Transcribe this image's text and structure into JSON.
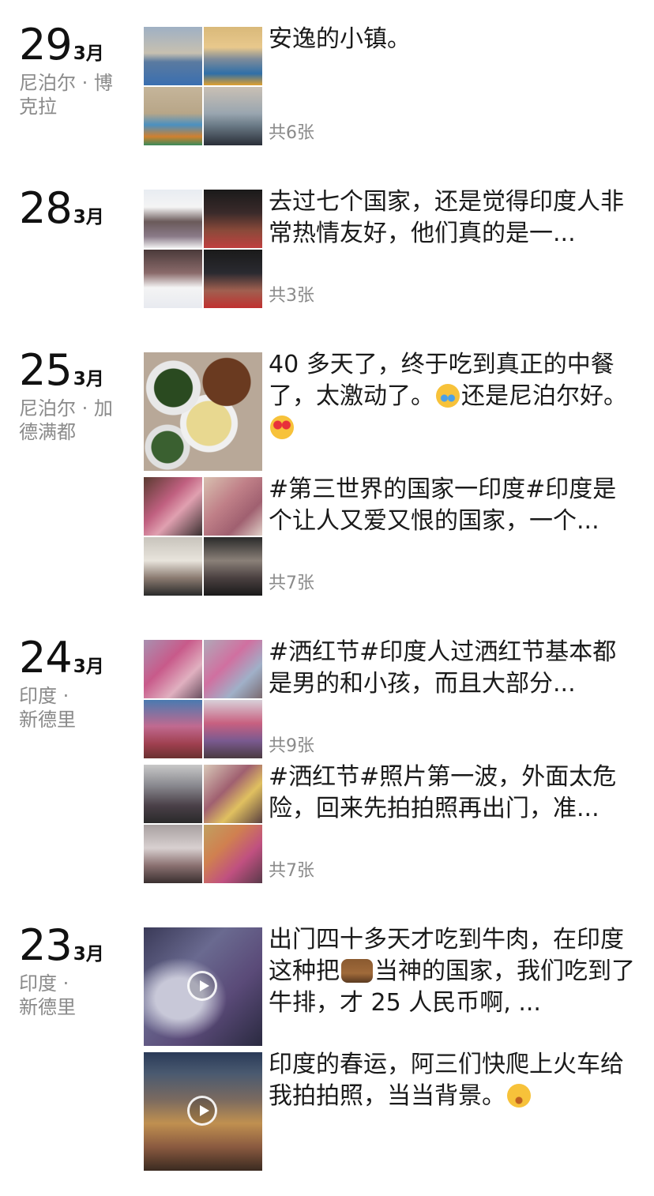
{
  "days": [
    {
      "day": "29",
      "month": "3月",
      "location": "尼泊尔 · 博克拉",
      "posts": [
        {
          "text": "安逸的小镇。",
          "count": "共6张"
        }
      ]
    },
    {
      "day": "28",
      "month": "3月",
      "location": "",
      "posts": [
        {
          "text": "去过七个国家，还是觉得印度人非常热情友好，他们真的是一...",
          "count": "共3张"
        }
      ]
    },
    {
      "day": "25",
      "month": "3月",
      "location": "尼泊尔 · 加德满都",
      "posts": [
        {
          "text_a": "40 多天了，终于吃到真正的中餐了，太激动了。",
          "text_b": "还是尼泊尔好。",
          "emoji_a": "crying-emoji",
          "emoji_b": "heart-eyes-emoji"
        },
        {
          "text": "#第三世界的国家一印度#印度是个让人又爱又恨的国家，一个...",
          "count": "共7张"
        }
      ]
    },
    {
      "day": "24",
      "month": "3月",
      "location": "印度 · 新德里",
      "posts": [
        {
          "text": "#洒红节#印度人过洒红节基本都是男的和小孩，而且大部分...",
          "count": "共9张"
        },
        {
          "text": "#洒红节#照片第一波，外面太危险，回来先拍拍照再出门，准...",
          "count": "共7张"
        }
      ]
    },
    {
      "day": "23",
      "month": "3月",
      "location": "印度 · 新德里",
      "posts": [
        {
          "text_a": "出门四十多天才吃到牛肉，在印度这种把",
          "text_b": "当神的国家，我们吃到了牛排，才 25 人民币啊, ...",
          "emoji": "cow-emoji"
        },
        {
          "text": "印度的春运，阿三们快爬上火车给我拍拍照，当当背景。",
          "emoji": "smiling-emoji"
        }
      ]
    }
  ]
}
